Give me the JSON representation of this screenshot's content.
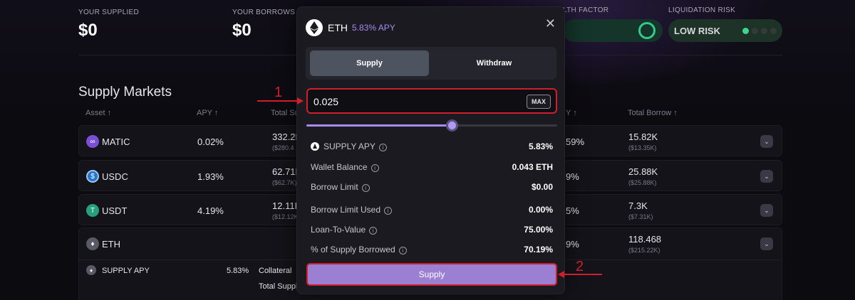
{
  "stats": {
    "supplied_label": "YOUR SUPPLIED",
    "supplied_value": "$0",
    "borrows_label": "YOUR BORROWS",
    "borrows_value": "$0",
    "health_label": "LTH FACTOR",
    "risk_label": "LIQUIDATION RISK",
    "risk_value": "LOW RISK",
    "risk_level": 1,
    "risk_level_max": 4,
    "risk_color": "#3ed68c"
  },
  "markets": {
    "title": "Supply Markets",
    "headers": {
      "asset": "Asset ↑",
      "apy": "APY ↑",
      "total_supply": "Total Su",
      "borrow_apy": "Y ↑",
      "total_borrow": "Total Borrow ↑"
    },
    "rows": [
      {
        "asset": "MATIC",
        "icon": "matic-icon",
        "apy": "0.02%",
        "total_supply": "332.2K",
        "total_supply_usd": "($280.4",
        "borrow_apy": "59%",
        "total_borrow": "15.82K",
        "total_borrow_usd": "($13.35K)"
      },
      {
        "asset": "USDC",
        "icon": "usdc-icon",
        "apy": "1.93%",
        "total_supply": "62.71K",
        "total_supply_usd": "($62.7K)",
        "borrow_apy": "9%",
        "total_borrow": "25.88K",
        "total_borrow_usd": "($25.88K)"
      },
      {
        "asset": "USDT",
        "icon": "usdt-icon",
        "apy": "4.19%",
        "total_supply": "12.11K",
        "total_supply_usd": "($12.12K",
        "borrow_apy": "5%",
        "total_borrow": "7.3K",
        "total_borrow_usd": "($7.31K)"
      },
      {
        "asset": "ETH",
        "icon": "eth-icon",
        "apy": "",
        "total_supply": "",
        "total_supply_usd": "",
        "borrow_apy": "9%",
        "total_borrow": "118.468",
        "total_borrow_usd": "($215.22K)"
      }
    ],
    "eth_details": {
      "supply_apy_label": "SUPPLY APY",
      "supply_apy_value": "5.83%",
      "collateral_label": "Collateral",
      "total_supply_label": "Total Suppl"
    }
  },
  "modal": {
    "asset": "ETH",
    "apy": "5.83% APY",
    "tabs": [
      "Supply",
      "Withdraw"
    ],
    "active_tab": "Supply",
    "amount_value": "0.025",
    "max_label": "MAX",
    "slider_fraction": 0.58,
    "info": [
      {
        "label": "SUPPLY APY",
        "value": "5.83%"
      },
      {
        "label": "Wallet Balance",
        "value": "0.043 ETH"
      },
      {
        "label": "Borrow Limit",
        "value": "$0.00"
      },
      {
        "label": "Borrow Limit Used",
        "value": "0.00%"
      },
      {
        "label": "Loan-To-Value",
        "value": "75.00%"
      },
      {
        "label": "% of Supply Borrowed",
        "value": "70.19%"
      }
    ],
    "submit_label": "Supply"
  },
  "annotations": {
    "step1": "1",
    "step2": "2",
    "color": "#d01f2c"
  }
}
